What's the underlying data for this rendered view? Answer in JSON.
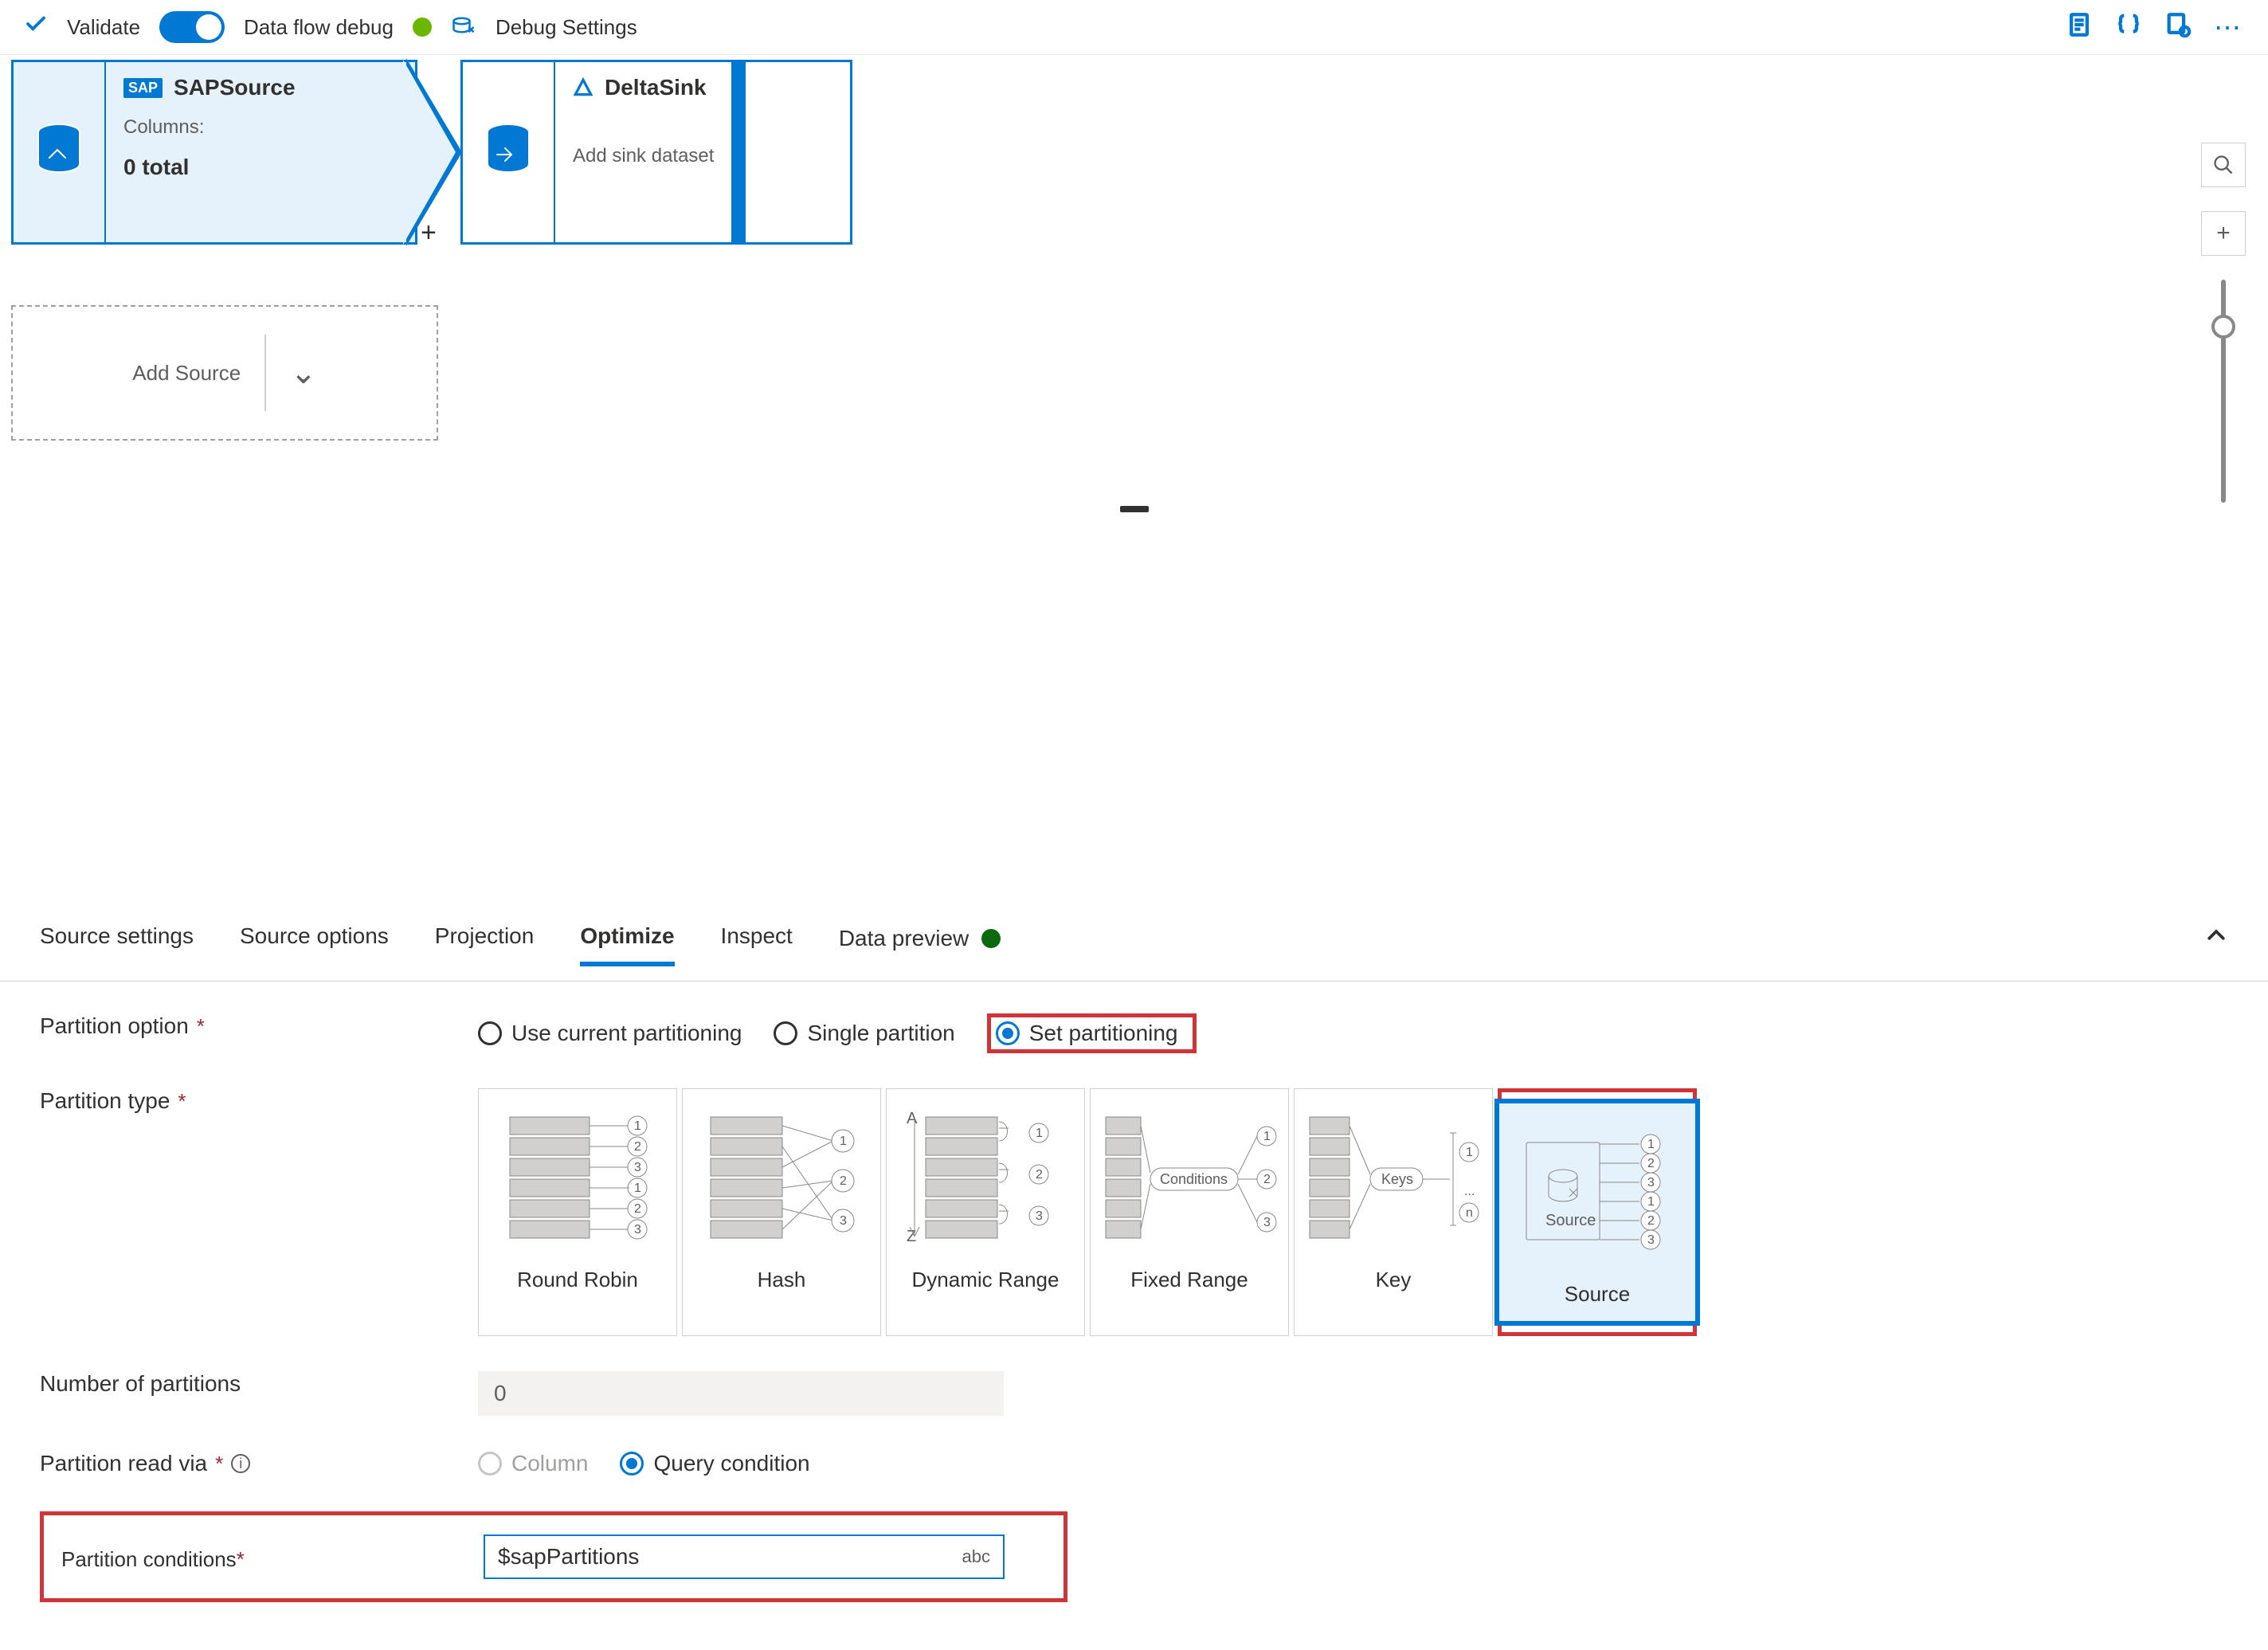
{
  "toolbar": {
    "validate": "Validate",
    "debug_label": "Data flow debug",
    "debug_settings": "Debug Settings"
  },
  "canvas": {
    "sap": {
      "title": "SAPSource",
      "columns_label": "Columns:",
      "columns_value": "0 total"
    },
    "delta": {
      "title": "DeltaSink",
      "subtitle": "Add sink dataset"
    },
    "add_source": "Add Source"
  },
  "tabs": {
    "source_settings": "Source settings",
    "source_options": "Source options",
    "projection": "Projection",
    "optimize": "Optimize",
    "inspect": "Inspect",
    "data_preview": "Data preview"
  },
  "form": {
    "partition_option_label": "Partition option",
    "radios": {
      "use_current": "Use current partitioning",
      "single": "Single partition",
      "set": "Set partitioning"
    },
    "partition_type_label": "Partition type",
    "tiles": {
      "round_robin": "Round Robin",
      "hash": "Hash",
      "dynamic_range": "Dynamic Range",
      "fixed_range": "Fixed Range",
      "key": "Key",
      "source": "Source"
    },
    "source_tile_caption": "Source",
    "num_partitions_label": "Number of partitions",
    "num_partitions_value": "0",
    "read_via_label": "Partition read via",
    "read_via_column": "Column",
    "read_via_query": "Query condition",
    "conditions_label": "Partition conditions",
    "conditions_value": "$sapPartitions",
    "conditions_suffix": "abc"
  }
}
